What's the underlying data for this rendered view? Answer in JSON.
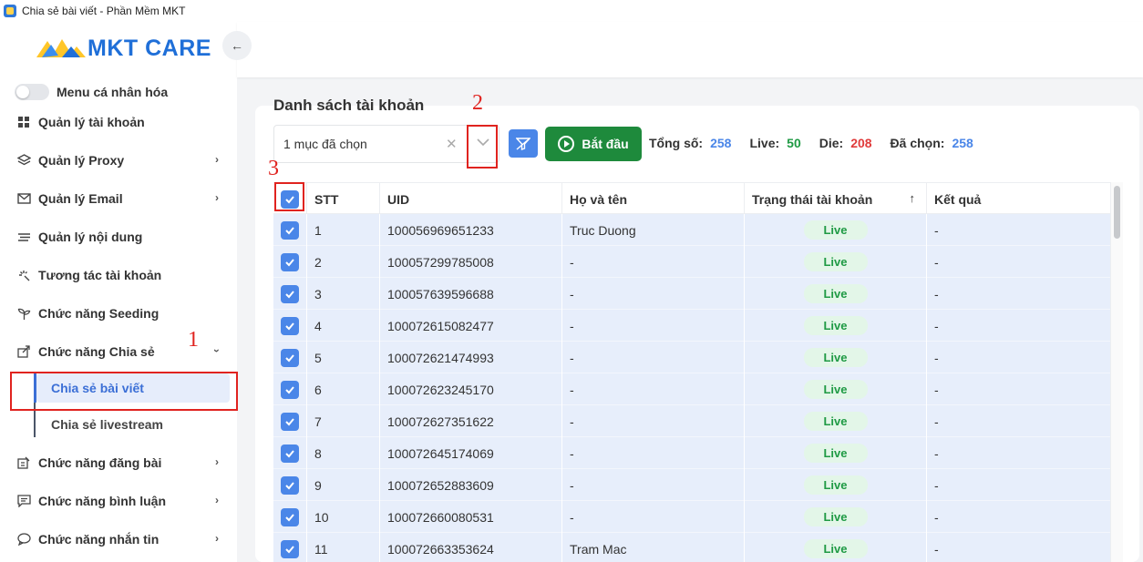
{
  "window": {
    "title": "Chia sẻ bài viết - Phần Mềm MKT"
  },
  "brand": {
    "name": "MKT CARE",
    "colors": {
      "primary": "#1f6fd8",
      "accent": "#ffc629"
    }
  },
  "sidebar": {
    "toggle_label": "Menu cá nhân hóa",
    "items": [
      {
        "label": "Quản lý tài khoản",
        "icon": "grid-icon"
      },
      {
        "label": "Quản lý Proxy",
        "icon": "layers-icon"
      },
      {
        "label": "Quản lý Email",
        "icon": "mail-icon"
      },
      {
        "label": "Quản lý nội dung",
        "icon": "stack-icon"
      },
      {
        "label": "Tương tác tài khoản",
        "icon": "sparkle-icon"
      },
      {
        "label": "Chức năng Seeding",
        "icon": "sprout-icon"
      },
      {
        "label": "Chức năng Chia sẻ",
        "icon": "share-icon"
      },
      {
        "label": "Chức năng đăng bài",
        "icon": "post-icon"
      },
      {
        "label": "Chức năng bình luận",
        "icon": "comment-icon"
      },
      {
        "label": "Chức năng nhắn tin",
        "icon": "chat-icon"
      }
    ],
    "sub_items": [
      {
        "label": "Chia sẻ bài viết"
      },
      {
        "label": "Chia sẻ livestream"
      }
    ]
  },
  "annotations": {
    "n1": "1",
    "n2": "2",
    "n3": "3"
  },
  "main": {
    "title": "Danh sách tài khoản",
    "select_value": "1 mục đã chọn",
    "start_label": "Bắt đầu",
    "stats": [
      {
        "label": "Tổng số:",
        "value": "258",
        "color": "#4a86e8"
      },
      {
        "label": "Live:",
        "value": "50",
        "color": "#1f9a44"
      },
      {
        "label": "Die:",
        "value": "208",
        "color": "#e03b3b"
      },
      {
        "label": "Đã chọn:",
        "value": "258",
        "color": "#4a86e8"
      }
    ],
    "table": {
      "headers": [
        "STT",
        "UID",
        "Họ và tên",
        "Trạng thái tài khoản",
        "Kết quả"
      ],
      "rows": [
        {
          "stt": "1",
          "uid": "100056969651233",
          "name": "Truc Duong",
          "status": "Live",
          "result": "-"
        },
        {
          "stt": "2",
          "uid": "100057299785008",
          "name": "-",
          "status": "Live",
          "result": "-"
        },
        {
          "stt": "3",
          "uid": "100057639596688",
          "name": "-",
          "status": "Live",
          "result": "-"
        },
        {
          "stt": "4",
          "uid": "100072615082477",
          "name": "-",
          "status": "Live",
          "result": "-"
        },
        {
          "stt": "5",
          "uid": "100072621474993",
          "name": "-",
          "status": "Live",
          "result": "-"
        },
        {
          "stt": "6",
          "uid": "100072623245170",
          "name": "-",
          "status": "Live",
          "result": "-"
        },
        {
          "stt": "7",
          "uid": "100072627351622",
          "name": "-",
          "status": "Live",
          "result": "-"
        },
        {
          "stt": "8",
          "uid": "100072645174069",
          "name": "-",
          "status": "Live",
          "result": "-"
        },
        {
          "stt": "9",
          "uid": "100072652883609",
          "name": "-",
          "status": "Live",
          "result": "-"
        },
        {
          "stt": "10",
          "uid": "100072660080531",
          "name": "-",
          "status": "Live",
          "result": "-"
        },
        {
          "stt": "11",
          "uid": "100072663353624",
          "name": "Tram Mac",
          "status": "Live",
          "result": "-"
        }
      ]
    }
  }
}
